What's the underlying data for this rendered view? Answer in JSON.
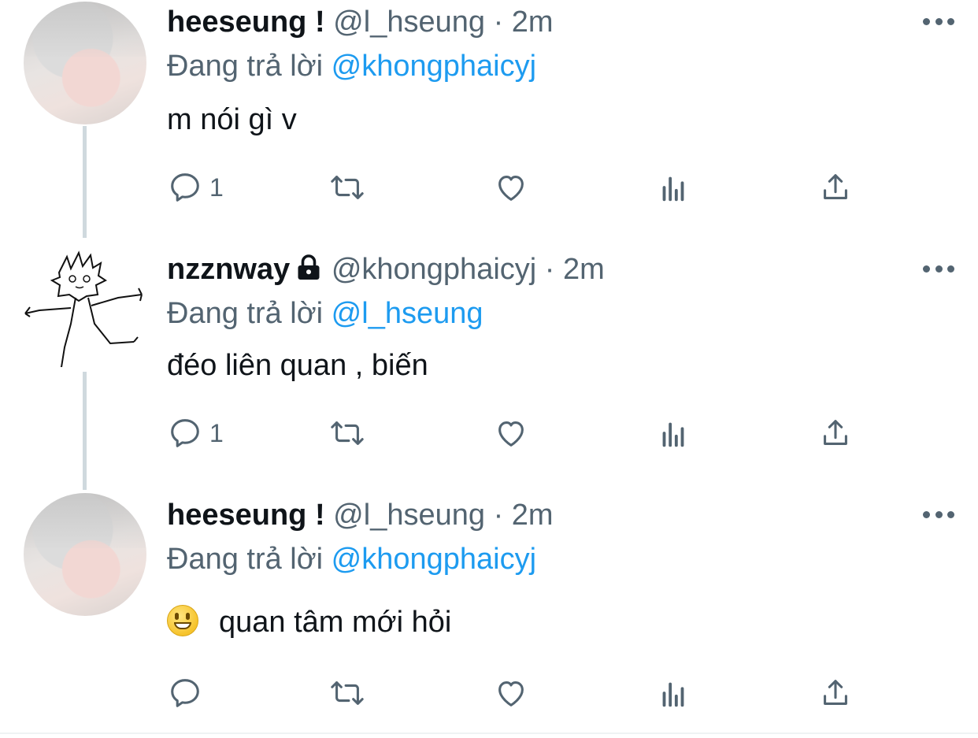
{
  "tweets": [
    {
      "name": "heeseung !",
      "handle": "@l_hseung",
      "sep": "·",
      "time": "2m",
      "replying_prefix": "Đang trả lời",
      "replying_to": "@khongphaicyj",
      "text": "m nói gì v",
      "reply_count": "1"
    },
    {
      "name": "nzznway",
      "handle": "@khongphaicyj",
      "sep": "·",
      "time": "2m",
      "replying_prefix": "Đang trả lời",
      "replying_to": "@l_hseung",
      "text": "đéo liên quan , biến",
      "reply_count": "1"
    },
    {
      "name": "heeseung !",
      "handle": "@l_hseung",
      "sep": "·",
      "time": "2m",
      "replying_prefix": "Đang trả lời",
      "replying_to": "@khongphaicyj",
      "text": "quan tâm mới hỏi",
      "reply_count": ""
    }
  ],
  "colors": {
    "mention": "#1d9bf0",
    "secondary": "#536471",
    "thread_line": "#cfd9de"
  },
  "icons": [
    "reply-icon",
    "retweet-icon",
    "like-icon",
    "analytics-icon",
    "share-icon",
    "more-icon",
    "lock-icon",
    "grinning-emoji"
  ]
}
